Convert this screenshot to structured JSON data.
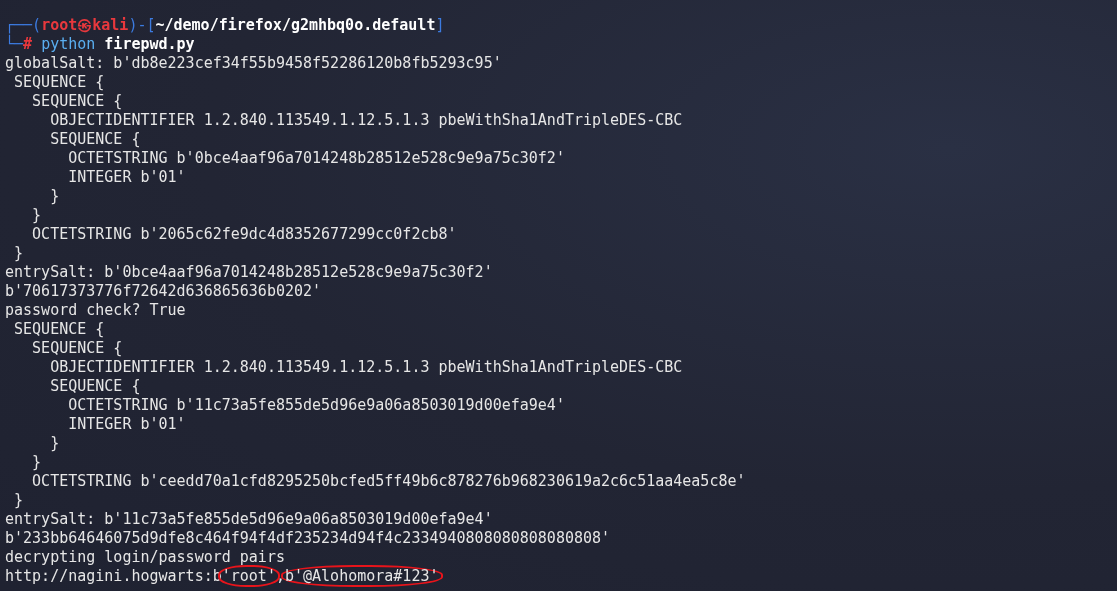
{
  "prompt": {
    "frame_open": "┌──(",
    "user_host": "root㉿kali",
    "frame_middle": ")-[",
    "cwd": "~/demo/firefox/g2mhbq0o.default",
    "frame_close": "]",
    "frame_lower": "└─",
    "symbol": "#",
    "command": "python",
    "argument": "firepwd.py"
  },
  "lines": [
    {
      "segments": [
        {
          "text": "globalSalt: b'db8e223cef34f55b9458f52286120b8fb5293c95'",
          "circled": false
        }
      ]
    },
    {
      "segments": [
        {
          "text": " SEQUENCE {",
          "circled": false
        }
      ]
    },
    {
      "segments": [
        {
          "text": "   SEQUENCE {",
          "circled": false
        }
      ]
    },
    {
      "segments": [
        {
          "text": "     OBJECTIDENTIFIER 1.2.840.113549.1.12.5.1.3 pbeWithSha1AndTripleDES-CBC",
          "circled": false
        }
      ]
    },
    {
      "segments": [
        {
          "text": "     SEQUENCE {",
          "circled": false
        }
      ]
    },
    {
      "segments": [
        {
          "text": "       OCTETSTRING b'0bce4aaf96a7014248b28512e528c9e9a75c30f2'",
          "circled": false
        }
      ]
    },
    {
      "segments": [
        {
          "text": "       INTEGER b'01'",
          "circled": false
        }
      ]
    },
    {
      "segments": [
        {
          "text": "     }",
          "circled": false
        }
      ]
    },
    {
      "segments": [
        {
          "text": "   }",
          "circled": false
        }
      ]
    },
    {
      "segments": [
        {
          "text": "   OCTETSTRING b'2065c62fe9dc4d8352677299cc0f2cb8'",
          "circled": false
        }
      ]
    },
    {
      "segments": [
        {
          "text": " }",
          "circled": false
        }
      ]
    },
    {
      "segments": [
        {
          "text": "entrySalt: b'0bce4aaf96a7014248b28512e528c9e9a75c30f2'",
          "circled": false
        }
      ]
    },
    {
      "segments": [
        {
          "text": "b'70617373776f72642d636865636b0202'",
          "circled": false
        }
      ]
    },
    {
      "segments": [
        {
          "text": "password check? True",
          "circled": false
        }
      ]
    },
    {
      "segments": [
        {
          "text": " SEQUENCE {",
          "circled": false
        }
      ]
    },
    {
      "segments": [
        {
          "text": "   SEQUENCE {",
          "circled": false
        }
      ]
    },
    {
      "segments": [
        {
          "text": "     OBJECTIDENTIFIER 1.2.840.113549.1.12.5.1.3 pbeWithSha1AndTripleDES-CBC",
          "circled": false
        }
      ]
    },
    {
      "segments": [
        {
          "text": "     SEQUENCE {",
          "circled": false
        }
      ]
    },
    {
      "segments": [
        {
          "text": "       OCTETSTRING b'11c73a5fe855de5d96e9a06a8503019d00efa9e4'",
          "circled": false
        }
      ]
    },
    {
      "segments": [
        {
          "text": "       INTEGER b'01'",
          "circled": false
        }
      ]
    },
    {
      "segments": [
        {
          "text": "     }",
          "circled": false
        }
      ]
    },
    {
      "segments": [
        {
          "text": "   }",
          "circled": false
        }
      ]
    },
    {
      "segments": [
        {
          "text": "   OCTETSTRING b'ceedd70a1cfd8295250bcfed5ff49b6c878276b968230619a2c6c51aa4ea5c8e'",
          "circled": false
        }
      ]
    },
    {
      "segments": [
        {
          "text": " }",
          "circled": false
        }
      ]
    },
    {
      "segments": [
        {
          "text": "entrySalt: b'11c73a5fe855de5d96e9a06a8503019d00efa9e4'",
          "circled": false
        }
      ]
    },
    {
      "segments": [
        {
          "text": "b'233bb64646075d9dfe8c464f94f4df235234d94f4c2334940808080808080808'",
          "circled": false
        }
      ]
    },
    {
      "segments": [
        {
          "text": "decrypting login/password pairs",
          "circled": false
        }
      ]
    },
    {
      "segments": [
        {
          "text": "http://nagini.hogwarts:b",
          "circled": false
        },
        {
          "text": "'root'",
          "circled": true
        },
        {
          "text": ",",
          "circled": false
        },
        {
          "text": "b'@Alohomora#123'",
          "circled": true
        }
      ]
    }
  ]
}
